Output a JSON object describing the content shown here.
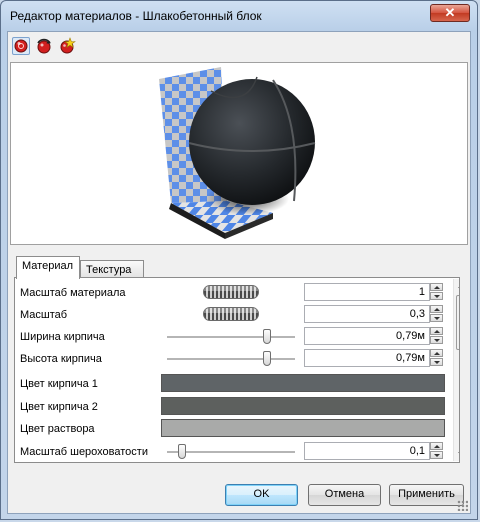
{
  "window": {
    "title": "Редактор материалов - Шлакобетонный блок",
    "close_glyph": "✕"
  },
  "toolbar": {
    "icons": [
      "sphere-red-icon",
      "sphere-refresh-icon",
      "sphere-star-icon"
    ]
  },
  "tabs": [
    {
      "label": "Материал",
      "active": true
    },
    {
      "label": "Текстура",
      "active": false
    }
  ],
  "properties": {
    "material_scale": {
      "label": "Масштаб материала",
      "value": "1"
    },
    "scale": {
      "label": "Масштаб",
      "value": "0,3"
    },
    "brick_width": {
      "label": "Ширина кирпича",
      "value": "0,79м",
      "slider_fraction": 0.78
    },
    "brick_height": {
      "label": "Высота кирпича",
      "value": "0,79м",
      "slider_fraction": 0.78
    },
    "brick_color_1": {
      "label": "Цвет кирпича 1",
      "color": "#5f6467"
    },
    "brick_color_2": {
      "label": "Цвет кирпича 2",
      "color": "#5d605e"
    },
    "mortar_color": {
      "label": "Цвет раствора",
      "color": "#a9aaa9"
    },
    "roughness_scale": {
      "label": "Масштаб шероховатости",
      "value": "0,1",
      "slider_fraction": 0.12
    }
  },
  "buttons": {
    "ok": "OK",
    "cancel": "Отмена",
    "apply": "Применить"
  }
}
